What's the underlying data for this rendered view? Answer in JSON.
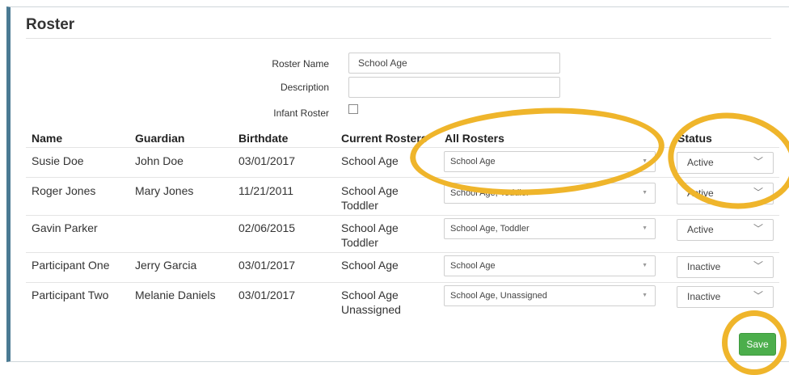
{
  "page": {
    "title": "Roster"
  },
  "form": {
    "roster_name_label": "Roster Name",
    "roster_name_value": "School Age",
    "description_label": "Description",
    "description_value": "",
    "infant_label": "Infant Roster"
  },
  "table": {
    "headers": [
      "Name",
      "Guardian",
      "Birthdate",
      "Current Rosters",
      "All Rosters",
      "Status"
    ],
    "rows": [
      {
        "name": "Susie Doe",
        "guardian": "John Doe",
        "birthdate": "03/01/2017",
        "current_1": "School Age",
        "current_2": "",
        "all_rosters": "School Age",
        "status": "Active"
      },
      {
        "name": "Roger Jones",
        "guardian": "Mary Jones",
        "birthdate": "11/21/2011",
        "current_1": "School Age",
        "current_2": "Toddler",
        "all_rosters": "School Age, Toddler",
        "status": "Active"
      },
      {
        "name": "Gavin Parker",
        "guardian": "",
        "birthdate": "02/06/2015",
        "current_1": "School Age",
        "current_2": "Toddler",
        "all_rosters": "School Age, Toddler",
        "status": "Active"
      },
      {
        "name": "Participant One",
        "guardian": "Jerry Garcia",
        "birthdate": "03/01/2017",
        "current_1": "School Age",
        "current_2": "",
        "all_rosters": "School Age",
        "status": "Inactive"
      },
      {
        "name": "Participant Two",
        "guardian": "Melanie Daniels",
        "birthdate": "03/01/2017",
        "current_1": "School Age",
        "current_2": "Unassigned",
        "all_rosters": "School Age, Unassigned",
        "status": "Inactive"
      }
    ]
  },
  "actions": {
    "save_label": "Save"
  },
  "colors": {
    "accent_bar": "#4a7a93",
    "save_green": "#4cae4c",
    "annotation": "#efb52b"
  }
}
